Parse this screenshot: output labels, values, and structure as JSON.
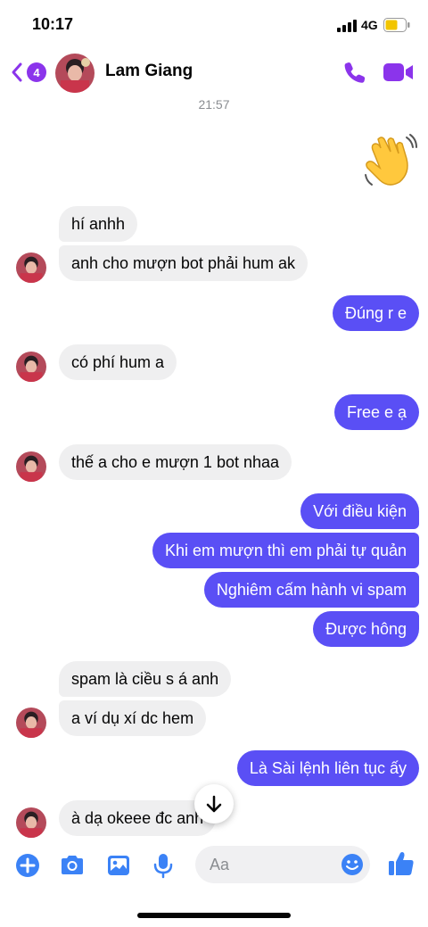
{
  "status_bar": {
    "time": "10:17",
    "network": "4G"
  },
  "header": {
    "unread_badge": "4",
    "contact_name": "Lam Giang"
  },
  "timestamp": "21:57",
  "messages": [
    {
      "text": "hí anhh"
    },
    {
      "text": "anh cho mượn bot phải hum ak"
    },
    {
      "text": "Đúng r e"
    },
    {
      "text": "có phí hum a"
    },
    {
      "text": "Free e ạ"
    },
    {
      "text": "thế a cho e mượn 1 bot nhaa"
    },
    {
      "text": "Với điều kiện"
    },
    {
      "text": "Khi em mượn thì em phải tự quản"
    },
    {
      "text": "Nghiêm cấm hành vi spam"
    },
    {
      "text": "Được hông"
    },
    {
      "text": "spam là ciều s á anh"
    },
    {
      "text": "a ví dụ xí dc hem"
    },
    {
      "text": "Là Sài lệnh liên tục ấy"
    },
    {
      "text": "à dạ okeee đc anh"
    }
  ],
  "composer": {
    "placeholder": "Aa"
  },
  "colors": {
    "accent": "#8b34eb",
    "outgoing_bubble": "#5a4ff5",
    "incoming_bubble": "#efeff0",
    "composer_icon": "#3b82f6"
  },
  "icons": [
    "back-chevron-icon",
    "phone-icon",
    "video-icon",
    "waving-hand-icon",
    "arrow-down-icon",
    "plus-icon",
    "camera-icon",
    "image-icon",
    "microphone-icon",
    "emoji-icon",
    "thumbs-up-icon"
  ]
}
